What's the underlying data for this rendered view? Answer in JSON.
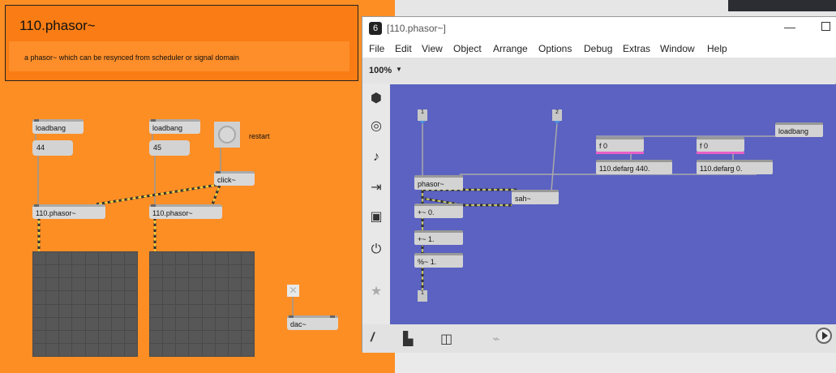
{
  "left_patch": {
    "title": "110.phasor~",
    "description": "a phasor~ which can be resynced from scheduler or signal domain",
    "loadbang_1": "loadbang",
    "loadbang_2": "loadbang",
    "msg_44": "44",
    "msg_45": "45",
    "restart_label": "restart",
    "click_obj": "click~",
    "phasor_1": "110.phasor~",
    "phasor_2": "110.phasor~",
    "dac": "dac~",
    "toggle_icon": "close-x-icon"
  },
  "window": {
    "title": "[110.phasor~]",
    "logo": "6",
    "menu": [
      "File",
      "Edit",
      "View",
      "Object",
      "Arrange",
      "Options",
      "Debug",
      "Extras",
      "Window",
      "Help"
    ],
    "zoom": "100%",
    "left_tools": [
      "cube-icon",
      "target-icon",
      "music-note-icon",
      "step-forward-icon",
      "image-icon",
      "plug-icon",
      "star-icon"
    ],
    "bottom_tools": [
      "edit-pencil-icon",
      "presentation-icon",
      "windows-icon",
      "paperclip-add-icon"
    ],
    "canvas_bg": "#5b62c1",
    "inner": {
      "inlet_1": "1",
      "inlet_2": "2",
      "outlet_1": "1",
      "phasor": "phasor~",
      "sah": "sah~",
      "plus_0": "+~ 0.",
      "plus_1": "+~ 1.",
      "mod_1": "%~ 1.",
      "f0_a": "f 0",
      "f0_b": "f 0",
      "defarg_440": "110.defarg 440.",
      "defarg_0": "110.defarg 0.",
      "loadbang": "loadbang"
    }
  }
}
